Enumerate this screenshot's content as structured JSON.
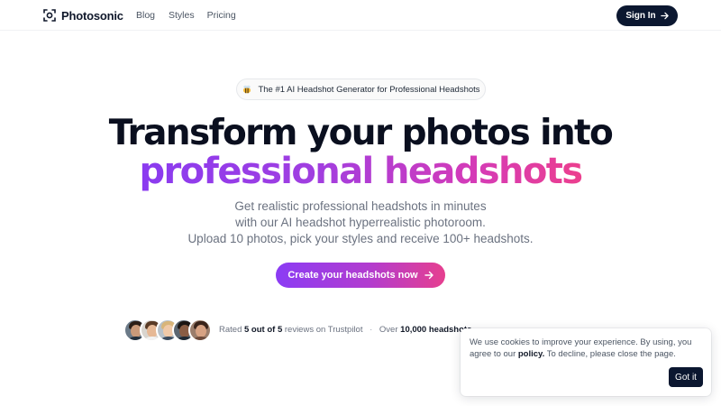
{
  "brand": {
    "name": "Photosonic"
  },
  "nav": {
    "links": [
      "Blog",
      "Styles",
      "Pricing"
    ],
    "signin_label": "Sign In"
  },
  "badge": {
    "text": "The #1 AI Headshot Generator for Professional Headshots"
  },
  "hero": {
    "line1": "Transform your photos into",
    "line2": "professional headshots",
    "sub1": "Get realistic professional headshots in minutes",
    "sub2": "with our AI headshot hyperrealistic photoroom.",
    "sub3": "Upload 10 photos, pick your styles and receive 100+ headshots.",
    "cta_label": "Create your headshots now"
  },
  "rating": {
    "prefix": "Rated",
    "score": "5 out of 5",
    "suffix": "reviews on Trustpilot",
    "separator": "·",
    "over": "Over",
    "count": "10,000 headshots"
  },
  "cookie": {
    "text_before": "We use cookies to improve your experience. By using, you agree to our",
    "link": "policy.",
    "text_after": "To decline, please close the page.",
    "button": "Got it"
  },
  "colors": {
    "nav_button": "#0b1730",
    "gradient_start": "#8a3bf0",
    "gradient_end": "#ec3f8e",
    "muted_text": "#6b7280"
  }
}
